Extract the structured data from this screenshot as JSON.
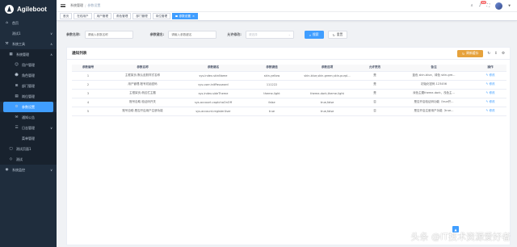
{
  "app": {
    "name": "Agileboot"
  },
  "sidebar": {
    "items": [
      {
        "label": "首页",
        "icon": "dashboard-icon",
        "level": 1
      },
      {
        "label": "测试1",
        "icon": "",
        "level": 1,
        "chevron": "∨"
      },
      {
        "label": "系统工具",
        "icon": "toolbox-icon",
        "level": 1,
        "chevron": "∧"
      },
      {
        "label": "系统管理",
        "icon": "system-icon",
        "level": 2,
        "chevron": "∧"
      },
      {
        "label": "用户管理",
        "icon": "user-icon",
        "level": 3
      },
      {
        "label": "角色管理",
        "icon": "role-icon",
        "level": 3
      },
      {
        "label": "部门管理",
        "icon": "dept-icon",
        "level": 3
      },
      {
        "label": "岗位管理",
        "icon": "post-icon",
        "level": 3
      },
      {
        "label": "参数设置",
        "icon": "settings-icon",
        "level": 3,
        "active": true
      },
      {
        "label": "通知公告",
        "icon": "notice-icon",
        "level": 3
      },
      {
        "label": "日志管理",
        "icon": "log-icon",
        "level": 3,
        "chevron": "∨"
      },
      {
        "label": "菜单管理",
        "icon": "",
        "level": 3
      },
      {
        "label": "测试页面1",
        "icon": "page-icon",
        "level": 2
      },
      {
        "label": "测试",
        "icon": "test-icon",
        "level": 2
      },
      {
        "label": "系统监控",
        "icon": "monitor-icon",
        "level": 1,
        "chevron": "∨"
      }
    ]
  },
  "navbar": {
    "breadcrumb": [
      "系统管理",
      "参数设置"
    ],
    "notification_count": "99"
  },
  "tags": [
    {
      "label": "首页",
      "active": false
    },
    {
      "label": "在线用户",
      "active": false
    },
    {
      "label": "用户管理",
      "active": false
    },
    {
      "label": "角色管理",
      "active": false
    },
    {
      "label": "部门管理",
      "active": false
    },
    {
      "label": "岗位管理",
      "active": false
    },
    {
      "label": "参数设置",
      "active": true,
      "close": "×"
    }
  ],
  "filter": {
    "param_name_label": "参数名称:",
    "param_name_placeholder": "请输入参数名称",
    "param_key_label": "参数键名:",
    "param_key_placeholder": "请输入参数键名",
    "allow_edit_label": "允许修改:",
    "allow_edit_placeholder": "请选择",
    "search_label": "搜索",
    "reset_label": "重置"
  },
  "card": {
    "title": "通知列表",
    "refresh_cache_label": "刷新缓存"
  },
  "table": {
    "headers": [
      "参数编号",
      "参数名称",
      "参数键名",
      "参数键值",
      "参数选项",
      "允许更改",
      "备注",
      "操作"
    ],
    "rows": [
      [
        "1",
        "主框架页-默认皮肤样式名称",
        "sys.index.skinName",
        "skin-yellow",
        "skin-blue,skin-green,skin-purpl...",
        "是",
        "蓝色 skin-blue、绿色 skin-gre...",
        "修改"
      ],
      [
        "2",
        "用户管理-账号初始密码",
        "sys.user.initPassword",
        "111222",
        "",
        "是",
        "初始化密码 123456",
        "修改"
      ],
      [
        "3",
        "主框架页-侧边栏主题",
        "sys.index.sideTheme",
        "theme-light",
        "theme-dark,theme-light",
        "是",
        "深色主题theme-dark，浅色主...",
        "修改"
      ],
      [
        "4",
        "账号自助-验证码开关",
        "sys.account.captchaOnOff",
        "false",
        "true,false",
        "否",
        "是否开启验证码功能（true开...",
        "修改"
      ],
      [
        "5",
        "账号自助-是否开启用户注册功能",
        "sys.account.registerUser",
        "true",
        "true,false",
        "否",
        "是否开启注册用户功能（true...",
        "修改"
      ]
    ]
  },
  "watermark": "头条 @IT技术资源爱好者",
  "colors": {
    "sidebar": "#1f2d3d",
    "primary": "#409eff",
    "warning": "#e6a23c",
    "danger": "#f56c6c"
  }
}
